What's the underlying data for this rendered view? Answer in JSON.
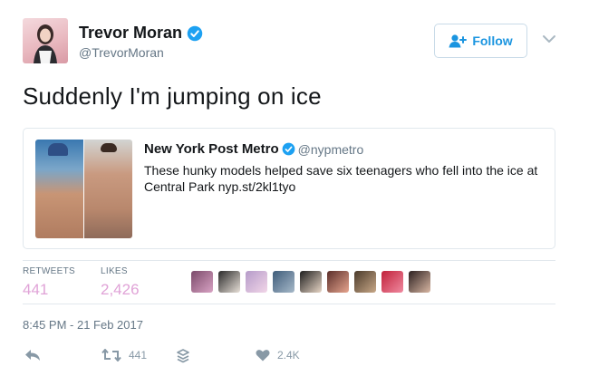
{
  "tweet": {
    "author": {
      "name": "Trevor Moran",
      "handle": "@TrevorMoran",
      "verified_icon": "verified-badge-icon",
      "avatar_icon": "avatar"
    },
    "follow_label": "Follow",
    "text": "Suddenly I'm jumping on ice",
    "quoted": {
      "name": "New York Post Metro",
      "handle": "@nypmetro",
      "text": "These hunky models helped save six teenagers who fell into the ice at Central Park nyp.st/2kl1tyo"
    },
    "stats": {
      "retweets_label": "RETWEETS",
      "retweets_value": "441",
      "likes_label": "LIKES",
      "likes_value": "2,426"
    },
    "liker_avatar_count": 9,
    "timestamp": "8:45 PM - 21 Feb 2017",
    "actions": {
      "retweet_count": "441",
      "like_count": "2.4K"
    }
  },
  "colors": {
    "accent": "#1b95e0",
    "stat_value": "#e0a3d7",
    "muted": "#657786",
    "icon_grey": "#8899a6",
    "border": "#e1e8ed"
  }
}
